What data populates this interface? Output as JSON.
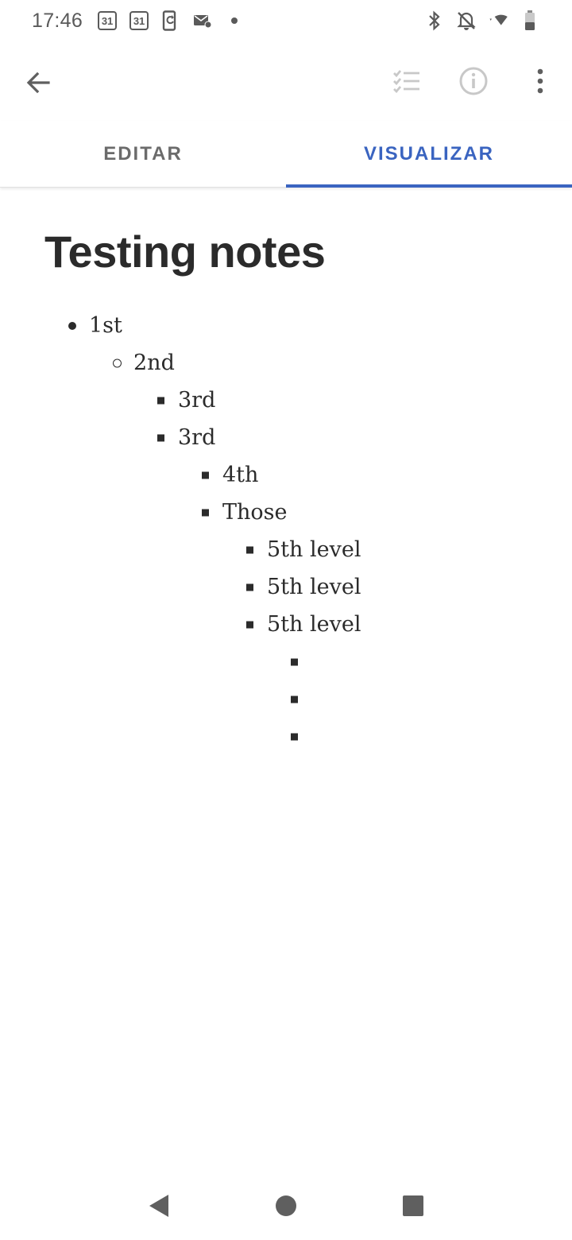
{
  "status_bar": {
    "time": "17:46",
    "left_icons": [
      "calendar-icon",
      "calendar-icon",
      "phone-sync-icon",
      "email-icon",
      "dot-icon"
    ],
    "calendar_day": "31",
    "right_icons": [
      "bluetooth-icon",
      "notifications-off-icon",
      "wifi-icon",
      "battery-icon"
    ]
  },
  "toolbar": {
    "back_icon": "arrow-back-icon",
    "checklist_icon": "checklist-icon",
    "info_icon": "info-icon",
    "more_icon": "more-vert-icon"
  },
  "tabs": [
    {
      "label": "EDITAR",
      "active": false
    },
    {
      "label": "VISUALIZAR",
      "active": true
    }
  ],
  "note": {
    "title": "Testing notes",
    "items": [
      {
        "text": "1st",
        "level": 1,
        "bullet": "disc"
      },
      {
        "text": "2nd",
        "level": 2,
        "bullet": "circle"
      },
      {
        "text": "3rd",
        "level": 3,
        "bullet": "square"
      },
      {
        "text": "3rd",
        "level": 3,
        "bullet": "square"
      },
      {
        "text": "4th",
        "level": 4,
        "bullet": "square"
      },
      {
        "text": "Those",
        "level": 4,
        "bullet": "square"
      },
      {
        "text": "5th level",
        "level": 5,
        "bullet": "square"
      },
      {
        "text": "5th level",
        "level": 5,
        "bullet": "square"
      },
      {
        "text": "5th level",
        "level": 5,
        "bullet": "square"
      },
      {
        "text": "",
        "level": 6,
        "bullet": "square"
      },
      {
        "text": "",
        "level": 6,
        "bullet": "square"
      },
      {
        "text": "",
        "level": 6,
        "bullet": "square"
      }
    ]
  },
  "nav_bar": {
    "back_icon": "nav-back-icon",
    "home_icon": "nav-home-icon",
    "recents_icon": "nav-recents-icon"
  },
  "colors": {
    "accent": "#3a64c0",
    "text": "#2b2b2b",
    "icon_gray": "#5f5f5f",
    "icon_disabled": "#c8c8c8"
  }
}
